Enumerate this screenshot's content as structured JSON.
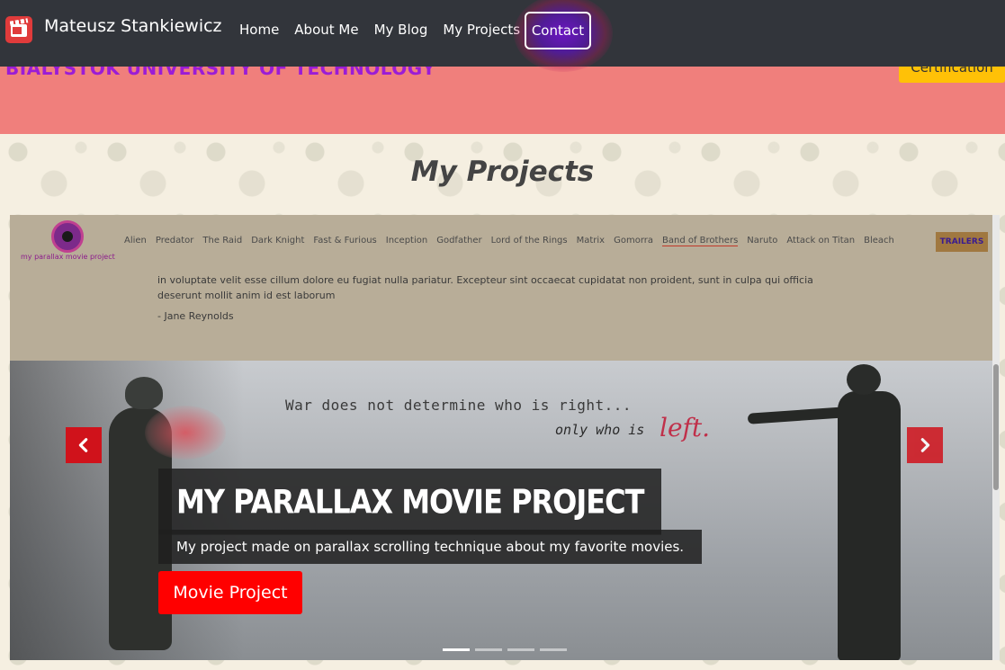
{
  "navbar": {
    "brand": "Mateusz Stankiewicz",
    "links": [
      "Home",
      "About Me",
      "My Blog",
      "My Projects"
    ],
    "contact": "Contact"
  },
  "strip": {
    "university": "BIALYSTOK UNIVERSITY OF TECHNOLOGY",
    "certification": "Certification"
  },
  "projects": {
    "title": "My Projects",
    "preview": {
      "logo_text": "my parallax movie project",
      "menu": [
        "Alien",
        "Predator",
        "The Raid",
        "Dark Knight",
        "Fast & Furious",
        "Inception",
        "Godfather",
        "Lord of the Rings",
        "Matrix",
        "Gomorra",
        "Band of Brothers",
        "Naruto",
        "Attack on Titan",
        "Bleach"
      ],
      "trailers": "TRAILERS",
      "quote_text": "in voluptate velit esse cillum dolore eu fugiat nulla pariatur. Excepteur sint occaecat cupidatat non proident, sunt in culpa qui officia deserunt mollit anim id est laborum",
      "quote_author": "- Jane Reynolds",
      "tagline_line1": "War does not determine who is right...",
      "tagline_line2": "only who is",
      "tagline_word": "left."
    },
    "slide": {
      "title": "MY PARALLAX MOVIE PROJECT",
      "subtitle": "My project made on parallax scrolling technique about my favorite movies.",
      "button": "Movie Project"
    },
    "colors": {
      "navbar": "#32353b",
      "strip": "#f07f7c",
      "accent_red": "#ff0000",
      "certification": "#ffc107"
    }
  }
}
